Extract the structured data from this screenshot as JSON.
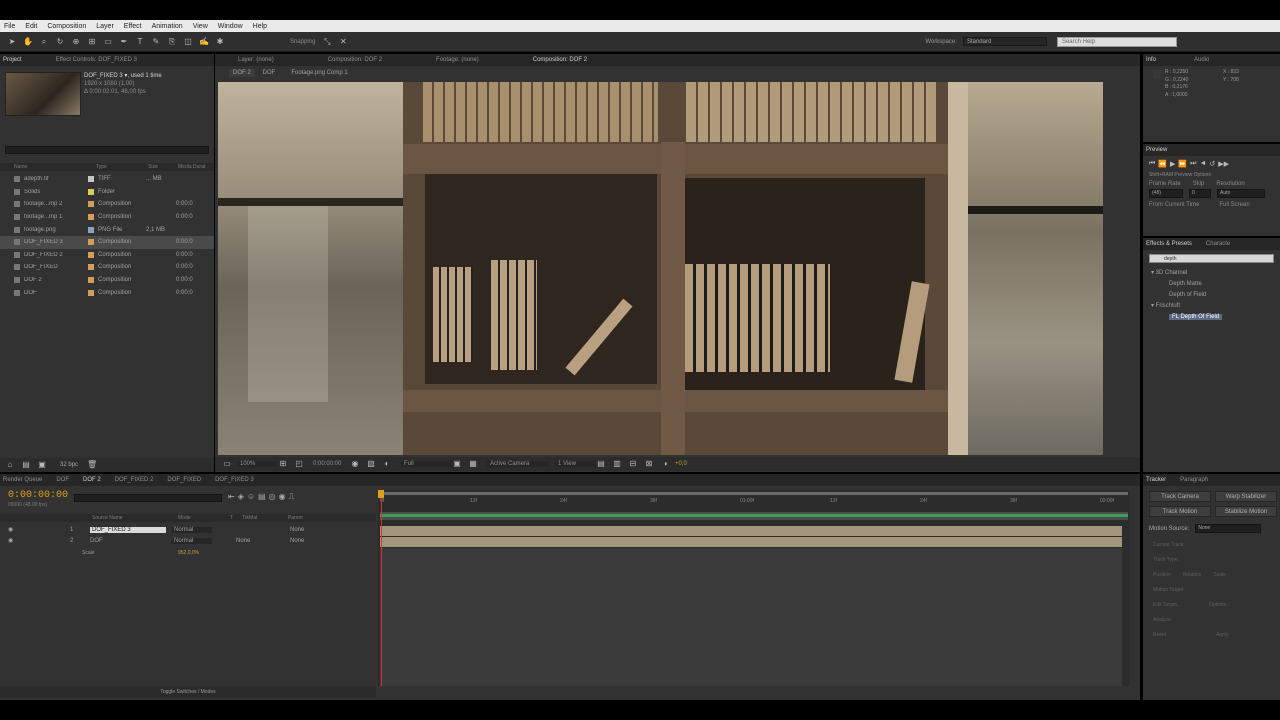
{
  "menu": [
    "File",
    "Edit",
    "Composition",
    "Layer",
    "Effect",
    "Animation",
    "View",
    "Window",
    "Help"
  ],
  "toolbar": {
    "snapping": "Snapping",
    "workspace_label": "Workspace:",
    "workspace_value": "Standard",
    "search_placeholder": "Search Help"
  },
  "project": {
    "tabs": [
      "Project",
      "Effect Controls: DOF_FIXED 3"
    ],
    "item_name": "DOF_FIXED 3 ▾, used 1 time",
    "item_size": "1920 x 1080 (1,00)",
    "item_duration": "Δ 0:00:02:01, 48,00 fps",
    "columns": [
      "Name",
      "Type",
      "Size",
      "Media Durat"
    ],
    "items": [
      {
        "name": "adepth.tif",
        "type": "TIFF",
        "size": "... MB",
        "dur": "",
        "color": "#c6c6c6"
      },
      {
        "name": "Solids",
        "type": "Folder",
        "size": "",
        "dur": "",
        "color": "#d7d052"
      },
      {
        "name": "footage...mp 2",
        "type": "Composition",
        "size": "",
        "dur": "0:00:0",
        "color": "#d09e58"
      },
      {
        "name": "footage...mp 1",
        "type": "Composition",
        "size": "",
        "dur": "0:00:0",
        "color": "#d09e58"
      },
      {
        "name": "footage.png",
        "type": "PNG File",
        "size": "2,1 MB",
        "dur": "",
        "color": "#8fa0c0"
      },
      {
        "name": "DOF_FIXED 3",
        "type": "Composition",
        "size": "",
        "dur": "0:00:0",
        "color": "#d09e58"
      },
      {
        "name": "DOF_FIXED 2",
        "type": "Composition",
        "size": "",
        "dur": "0:00:0",
        "color": "#d09e58"
      },
      {
        "name": "DOF_FIXED",
        "type": "Composition",
        "size": "",
        "dur": "0:00:0",
        "color": "#d09e58"
      },
      {
        "name": "DOF 2",
        "type": "Composition",
        "size": "",
        "dur": "0:00:0",
        "color": "#d09e58"
      },
      {
        "name": "DOF",
        "type": "Composition",
        "size": "",
        "dur": "0:00:0",
        "color": "#d09e58"
      }
    ],
    "bpc": "32 bpc"
  },
  "viewer": {
    "tabs": [
      "Layer: (none)",
      "Composition: DOF 2",
      "Footage: (none)",
      "Composition: DOF 2"
    ],
    "crumbs": [
      "DOF 2",
      "DOF",
      "Footage.png Comp 1"
    ],
    "zoom": "100%",
    "timecode": "0:00:00:00",
    "resolution": "Full",
    "camera": "Active Camera",
    "views": "1 View",
    "exposure": "+0,0"
  },
  "info": {
    "tabs": [
      "Info",
      "Audio"
    ],
    "r": "R : 0,2350",
    "g": "G : 0,2240",
    "b": "B : 0,2176",
    "a": "A : 1,0000",
    "x": "X : 833",
    "y": "Y : 708"
  },
  "preview": {
    "title": "Preview",
    "shortcut": "Shift+RAM Preview Options",
    "frame_rate_label": "Frame Rate",
    "skip_label": "Skip",
    "resolution_label": "Resolution",
    "frame_rate": "(48)",
    "skip": "0",
    "resolution": "Auto",
    "from_current": "From Current Time",
    "full_screen": "Full Screen"
  },
  "effects": {
    "tabs": [
      "Effects & Presets",
      "Characte"
    ],
    "search": "depth",
    "tree": [
      {
        "label": "▾ 3D Channel",
        "indent": 0
      },
      {
        "label": "Depth Matte",
        "indent": 1
      },
      {
        "label": "Depth of Field",
        "indent": 1
      },
      {
        "label": "▾ Frischluft",
        "indent": 0
      },
      {
        "label": "FL Depth Of Field",
        "indent": 1,
        "sel": true
      }
    ]
  },
  "timeline": {
    "tabs": [
      "Render Queue",
      "DOF",
      "DOF 2",
      "DOF_FIXED 2",
      "DOF_FIXED",
      "DOF_FIXED 3"
    ],
    "timecode": "0:00:00:00",
    "fps": "00000 (48.00 fps)",
    "columns": [
      "Source Name",
      "Mode",
      "T",
      "TrkMat",
      "Parent"
    ],
    "layers": [
      {
        "num": "1",
        "name": "DOF_FIXED 3",
        "mode": "Normal",
        "trk": "",
        "parent": "None"
      },
      {
        "num": "2",
        "name": "DOF",
        "mode": "Normal",
        "trk": "None",
        "parent": "None"
      }
    ],
    "prop_name": "Scale",
    "prop_value": "952,0,0%",
    "toggle": "Toggle Switches / Modes",
    "ruler": [
      "0f",
      "12f",
      "24f",
      "36f",
      "01:00f",
      "12f",
      "24f",
      "36f",
      "02:00f"
    ]
  },
  "tracker": {
    "tabs": [
      "Tracker",
      "Paragraph"
    ],
    "buttons": [
      "Track Camera",
      "Warp Stabilizer",
      "Track Motion",
      "Stabilize Motion"
    ],
    "motion_source_label": "Motion Source:",
    "motion_source": "None",
    "current_track": "Current Track:",
    "track_type": "Track Type:",
    "position": "Position",
    "rotation": "Rotation",
    "scale": "Scale",
    "motion_target": "Motion Target:",
    "edit_target": "Edit Target...",
    "options": "Options...",
    "analyze": "Analyze:",
    "reset": "Reset",
    "apply": "Apply"
  }
}
